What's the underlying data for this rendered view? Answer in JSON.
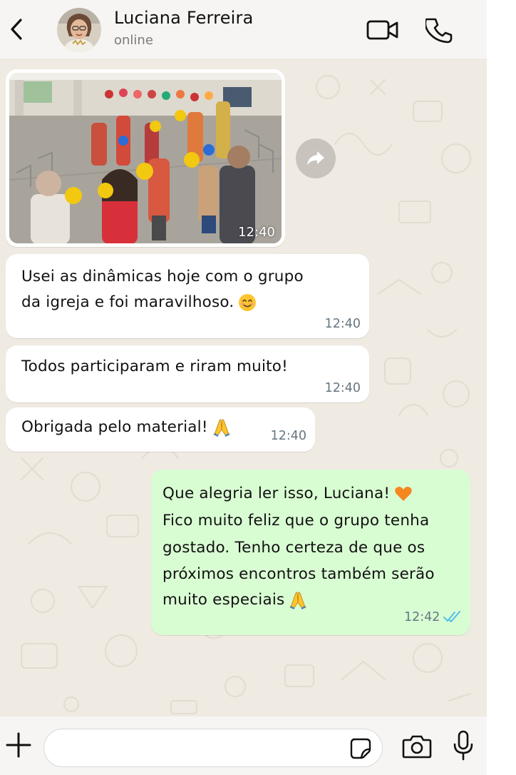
{
  "header": {
    "contact_name": "Luciana Ferreira",
    "status": "online"
  },
  "messages": [
    {
      "type": "image",
      "direction": "incoming",
      "time": "12:40"
    },
    {
      "type": "text",
      "direction": "incoming",
      "lines": [
        "Usei as dinâmicas hoje com o grupo",
        "da igreja e foi maravilhoso."
      ],
      "emoji": "smiling-face",
      "time": "12:40"
    },
    {
      "type": "text",
      "direction": "incoming",
      "lines": [
        "Todos participaram e riram muito!"
      ],
      "time": "12:40"
    },
    {
      "type": "text",
      "direction": "incoming",
      "lines": [
        "Obrigada pelo material!"
      ],
      "emoji": "folded-hands",
      "time": "12:40"
    },
    {
      "type": "text",
      "direction": "outgoing",
      "lines": [
        "Que alegria ler isso, Luciana!",
        "Fico muito feliz que o grupo tenha",
        "gostado. Tenho certeza de que os",
        "próximos encontros também serão",
        "muito especiais"
      ],
      "emojis": [
        "orange-heart",
        "folded-hands"
      ],
      "time": "12:42",
      "receipt": "read"
    }
  ],
  "composer": {
    "input_value": "",
    "placeholder": ""
  },
  "icons": {
    "back": "chevron-left-icon",
    "video": "video-camera-icon",
    "call": "phone-icon",
    "forward": "forward-icon",
    "plus": "plus-icon",
    "sticker": "sticker-icon",
    "camera": "camera-icon",
    "mic": "microphone-icon"
  },
  "colors": {
    "chat_background": "#efeae2",
    "incoming_bubble": "#ffffff",
    "outgoing_bubble": "#d9fdd3",
    "read_receipt": "#53bdeb",
    "bar_background": "#f6f5f3"
  }
}
